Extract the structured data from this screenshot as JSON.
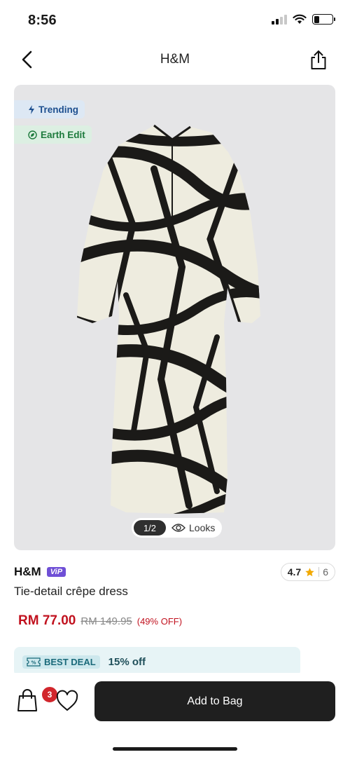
{
  "status_bar": {
    "time": "8:56"
  },
  "header": {
    "title": "H&M"
  },
  "gallery": {
    "tags": [
      {
        "label": "Trending",
        "icon": "bolt-icon"
      },
      {
        "label": "Earth Edit",
        "icon": "leaf-icon"
      }
    ],
    "pager": {
      "count": "1/2",
      "looks_label": "Looks"
    }
  },
  "product": {
    "brand": "H&M",
    "vip_badge": "ViP",
    "name": "Tie-detail crêpe dress",
    "rating": {
      "value": "4.7",
      "count": "6"
    },
    "price_now": "RM 77.00",
    "price_was": "RM 149.95",
    "discount": "(49% OFF)"
  },
  "deal": {
    "badge": "BEST DEAL",
    "text": "15% off"
  },
  "bottom_bar": {
    "bag_count": "3",
    "add_to_bag": "Add to Bag"
  },
  "colors": {
    "price_red": "#c1121f",
    "vip_purple": "#6f4fd6",
    "cta_black": "#1f1f1f",
    "deal_bg": "#e7f4f6"
  }
}
